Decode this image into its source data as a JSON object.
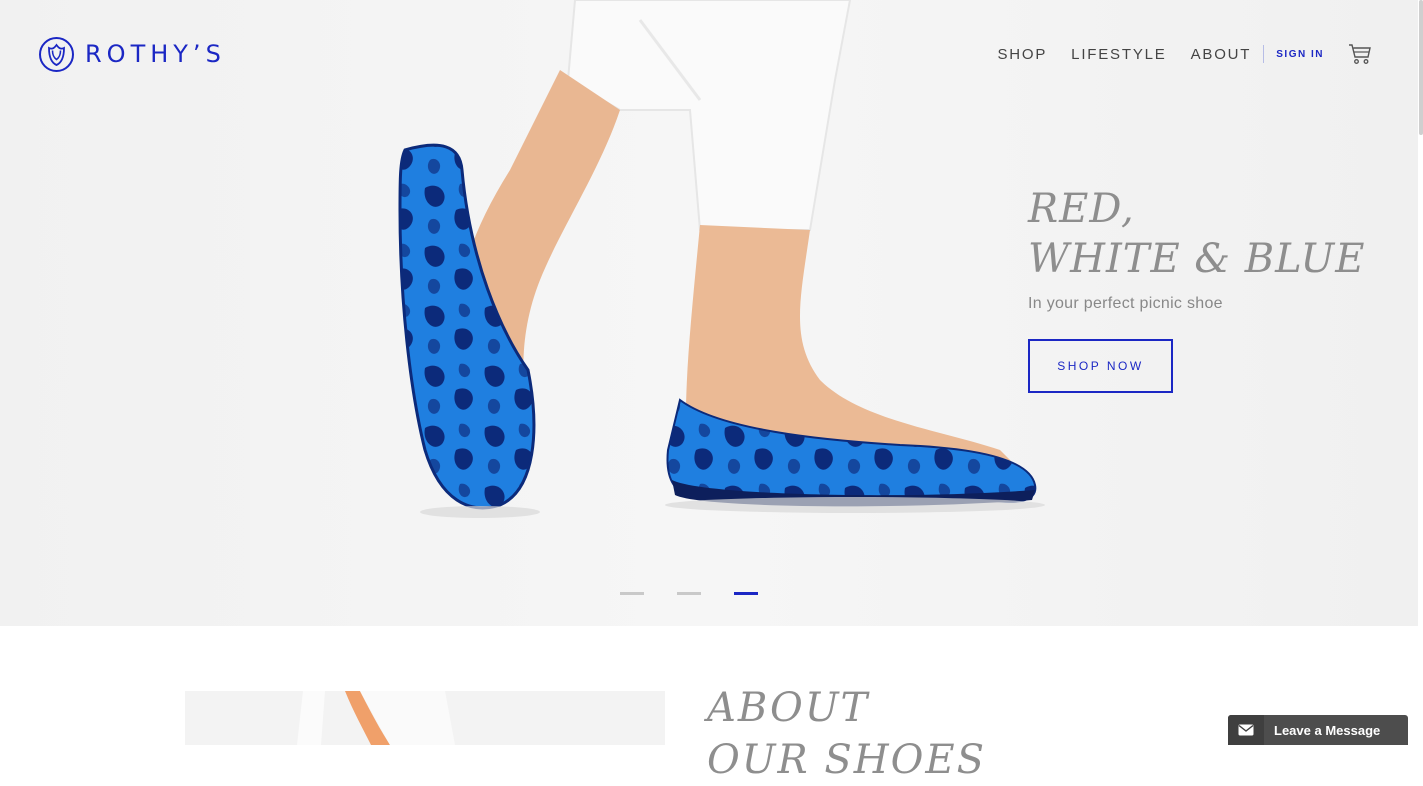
{
  "brand": {
    "name": "ROTHY’S",
    "color": "#1b27c4"
  },
  "nav": {
    "items": [
      {
        "label": "SHOP"
      },
      {
        "label": "LIFESTYLE"
      },
      {
        "label": "ABOUT"
      }
    ],
    "sign_in": "SIGN IN",
    "cart_icon": "cart-icon"
  },
  "hero": {
    "title_line1": "RED,",
    "title_line2": "WHITE & BLUE",
    "subtitle": "In your perfect picnic shoe",
    "cta": "SHOP NOW",
    "slides_total": 3,
    "active_slide": 3
  },
  "about": {
    "title_line1": "ABOUT",
    "title_line2": "OUR SHOES"
  },
  "chat": {
    "label": "Leave a Message",
    "icon": "envelope-icon"
  }
}
